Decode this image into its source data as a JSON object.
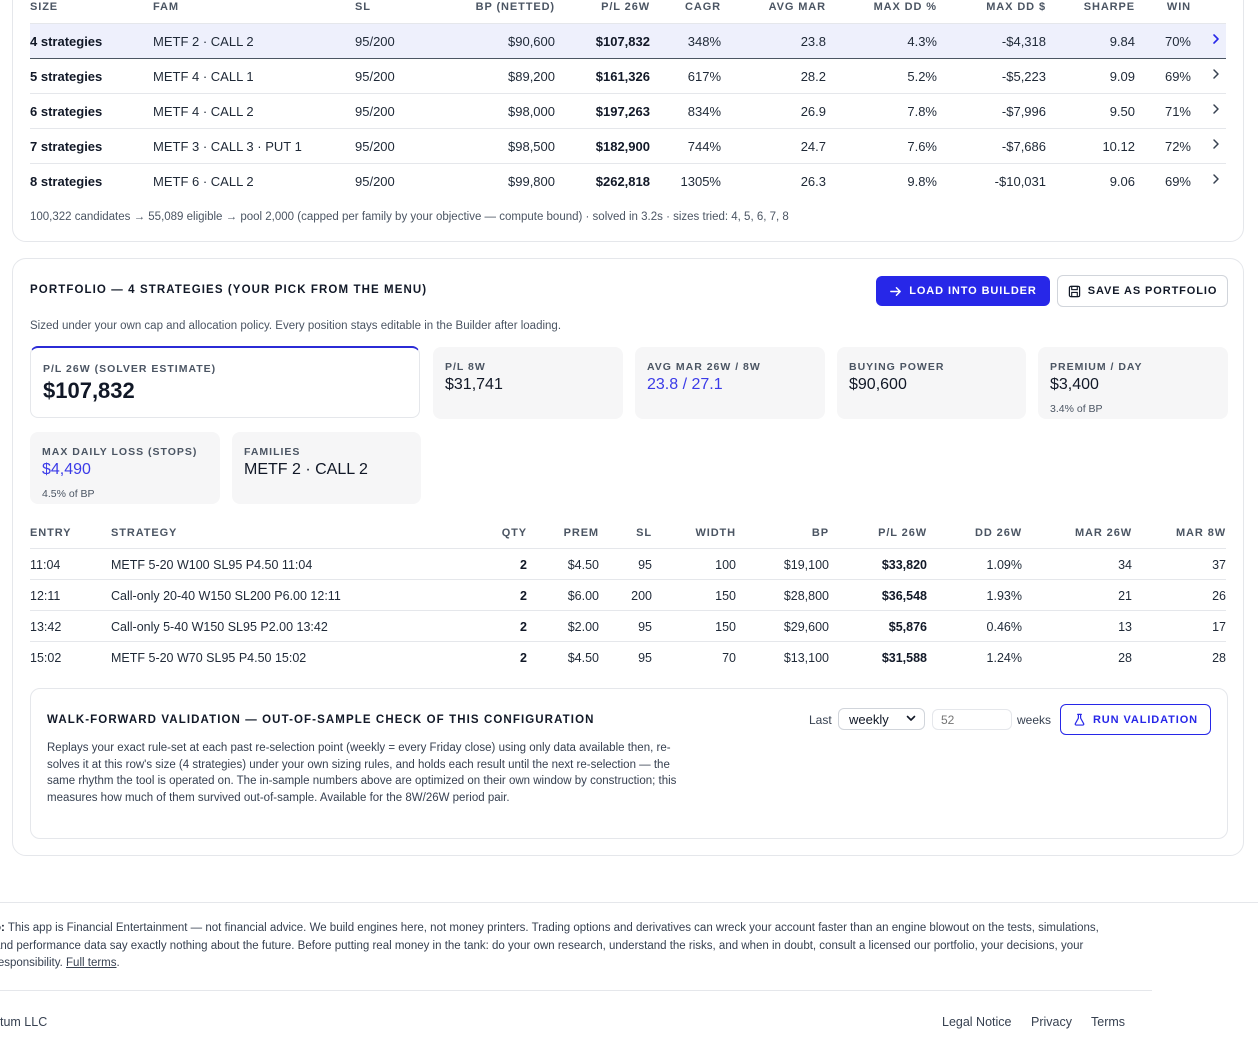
{
  "size_table": {
    "headers": [
      "SIZE",
      "FAM",
      "SL",
      "BP (NETTED)",
      "P/L 26W",
      "CAGR",
      "AVG MAR",
      "MAX DD %",
      "MAX DD $",
      "SHARPE",
      "WIN"
    ],
    "rows": [
      {
        "size": "4 strategies",
        "fam": "METF 2 · CALL 2",
        "sl": "95/200",
        "bp": "$90,600",
        "pl": "$107,832",
        "cagr": "348%",
        "mar": "23.8",
        "ddp": "4.3%",
        "ddd": "-$4,318",
        "sharpe": "9.84",
        "win": "70%"
      },
      {
        "size": "5 strategies",
        "fam": "METF 4 · CALL 1",
        "sl": "95/200",
        "bp": "$89,200",
        "pl": "$161,326",
        "cagr": "617%",
        "mar": "28.2",
        "ddp": "5.2%",
        "ddd": "-$5,223",
        "sharpe": "9.09",
        "win": "69%"
      },
      {
        "size": "6 strategies",
        "fam": "METF 4 · CALL 2",
        "sl": "95/200",
        "bp": "$98,000",
        "pl": "$197,263",
        "cagr": "834%",
        "mar": "26.9",
        "ddp": "7.8%",
        "ddd": "-$7,996",
        "sharpe": "9.50",
        "win": "71%"
      },
      {
        "size": "7 strategies",
        "fam": "METF 3 · CALL 3 · PUT 1",
        "sl": "95/200",
        "bp": "$98,500",
        "pl": "$182,900",
        "cagr": "744%",
        "mar": "24.7",
        "ddp": "7.6%",
        "ddd": "-$7,686",
        "sharpe": "10.12",
        "win": "72%"
      },
      {
        "size": "8 strategies",
        "fam": "METF 6 · CALL 2",
        "sl": "95/200",
        "bp": "$99,800",
        "pl": "$262,818",
        "cagr": "1305%",
        "mar": "26.3",
        "ddp": "9.8%",
        "ddd": "-$10,031",
        "sharpe": "9.06",
        "win": "69%"
      }
    ],
    "footnote": "100,322 candidates → 55,089 eligible → pool 2,000 (capped per family by your objective — compute bound) · solved in 3.2s · sizes tried: 4, 5, 6, 7, 8"
  },
  "portfolio": {
    "title": "PORTFOLIO — 4 STRATEGIES (YOUR PICK FROM THE MENU)",
    "subtitle": "Sized under your own cap and allocation policy. Every position stays editable in the Builder after loading.",
    "load_button": "LOAD INTO BUILDER",
    "save_button": "SAVE AS PORTFOLIO",
    "stats": {
      "pl26": {
        "label": "P/L 26W (SOLVER ESTIMATE)",
        "value": "$107,832"
      },
      "pl8": {
        "label": "P/L 8W",
        "value": "$31,741"
      },
      "mar": {
        "label": "AVG MAR 26W / 8W",
        "value": "23.8 / 27.1"
      },
      "bp": {
        "label": "BUYING POWER",
        "value": "$90,600"
      },
      "prem": {
        "label": "PREMIUM / DAY",
        "value": "$3,400",
        "note": "3.4% of BP"
      },
      "maxloss": {
        "label": "MAX DAILY LOSS (STOPS)",
        "value": "$4,490",
        "note": "4.5% of BP"
      },
      "families": {
        "label": "FAMILIES",
        "value": "METF 2 · CALL 2"
      }
    },
    "entries": {
      "headers": [
        "ENTRY",
        "STRATEGY",
        "QTY",
        "PREM",
        "SL",
        "WIDTH",
        "BP",
        "P/L 26W",
        "DD 26W",
        "MAR 26W",
        "MAR 8W"
      ],
      "rows": [
        {
          "entry": "11:04",
          "strategy": "METF 5-20 W100 SL95 P4.50 11:04",
          "qty": "2",
          "prem": "$4.50",
          "sl": "95",
          "width": "100",
          "bp": "$19,100",
          "pl": "$33,820",
          "dd": "1.09%",
          "mar26": "34",
          "mar8": "37"
        },
        {
          "entry": "12:11",
          "strategy": "Call-only 20-40 W150 SL200 P6.00 12:11",
          "qty": "2",
          "prem": "$6.00",
          "sl": "200",
          "width": "150",
          "bp": "$28,800",
          "pl": "$36,548",
          "dd": "1.93%",
          "mar26": "21",
          "mar8": "26"
        },
        {
          "entry": "13:42",
          "strategy": "Call-only 5-40 W150 SL95 P2.00 13:42",
          "qty": "2",
          "prem": "$2.00",
          "sl": "95",
          "width": "150",
          "bp": "$29,600",
          "pl": "$5,876",
          "dd": "0.46%",
          "mar26": "13",
          "mar8": "17"
        },
        {
          "entry": "15:02",
          "strategy": "METF 5-20 W70 SL95 P4.50 15:02",
          "qty": "2",
          "prem": "$4.50",
          "sl": "95",
          "width": "70",
          "bp": "$13,100",
          "pl": "$31,588",
          "dd": "1.24%",
          "mar26": "28",
          "mar8": "28"
        }
      ]
    }
  },
  "walk_forward": {
    "title": "WALK-FORWARD VALIDATION — OUT-OF-SAMPLE CHECK OF THIS CONFIGURATION",
    "description": "Replays your exact rule-set at each past re-selection point (weekly = every Friday close) using only data available then, re-solves it at this row's size (4 strategies) under your own sizing rules, and holds each result until the next re-selection — the same rhythm the tool is operated on. The in-sample numbers above are optimized on their own window by construction; this measures how much of them survived out-of-sample. Available for the 8W/26W period pair.",
    "last_label": "Last",
    "period_value": "weekly",
    "weeks_placeholder": "52",
    "weeks_label": "weeks",
    "run_button": "RUN VALIDATION"
  },
  "footer": {
    "disclaimer_lead": "o:",
    "disclaimer_body": "This app is Financial Entertainment — not financial advice. We build engines here, not money printers. Trading options and derivatives can wreck your account faster than an engine blowout on the tests, simulations, and performance data say exactly nothing about the future. Before putting real money in the tank: do your own research, understand the risks, and when in doubt, consult a licensed our portfolio, your decisions, your responsibility.",
    "full_terms": "Full terms",
    "company": "tum LLC",
    "links": [
      "Legal Notice",
      "Privacy",
      "Terms"
    ]
  },
  "colors": {
    "accent": "#2727e8",
    "selected_row": "#eef0fc",
    "accent_text": "#3b3be8"
  }
}
